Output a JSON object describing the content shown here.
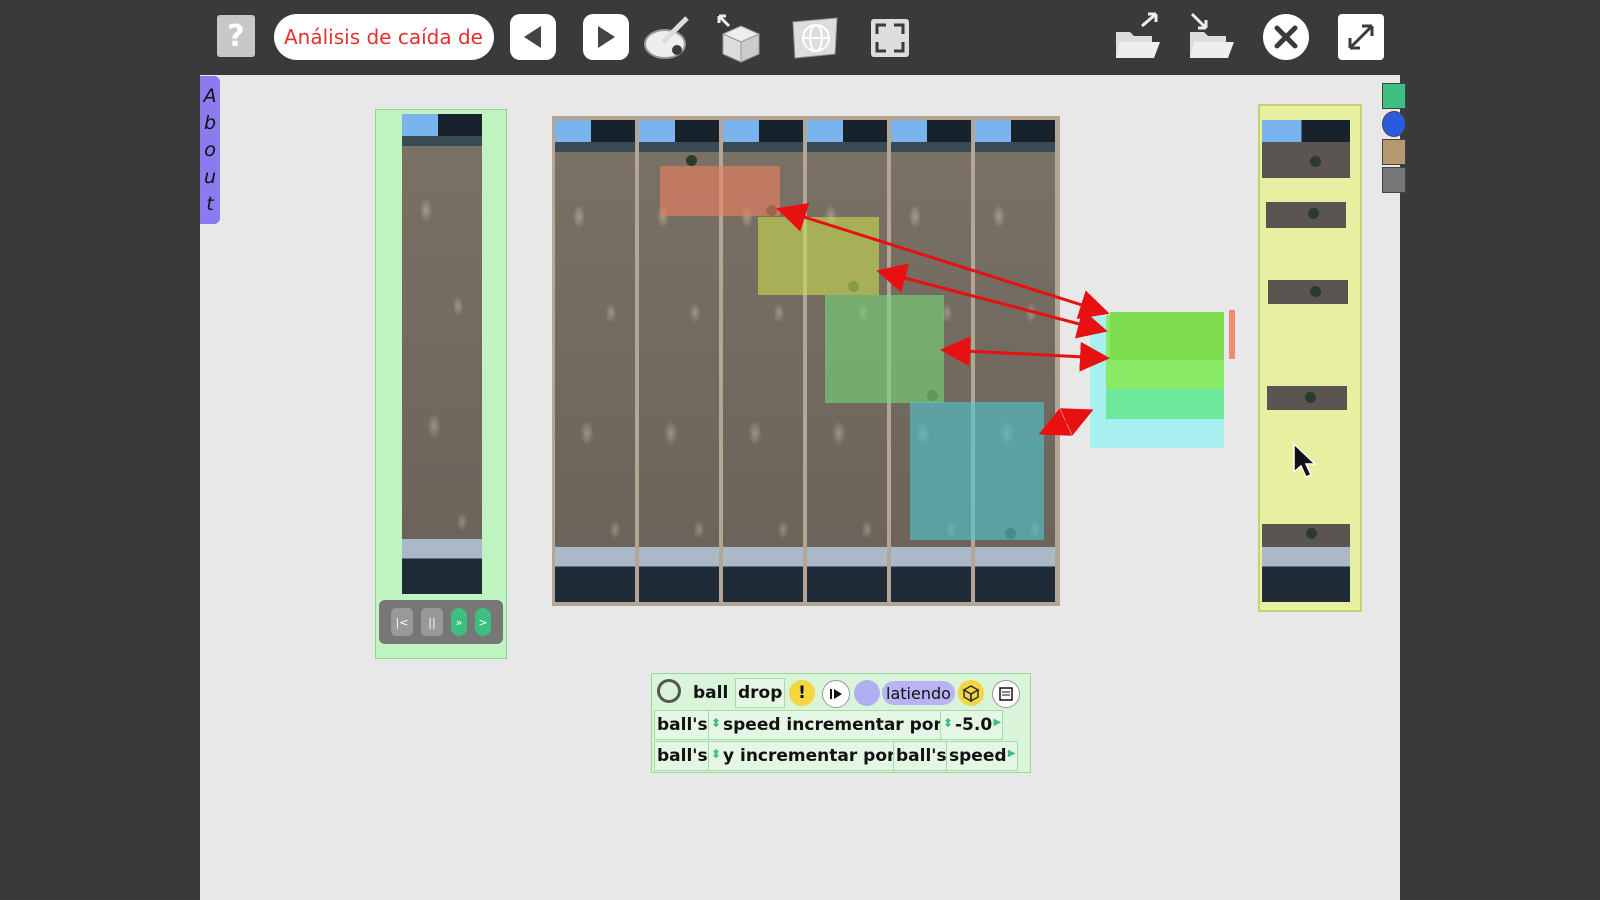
{
  "toolbar": {
    "help_label": "?",
    "project_title": "Análisis de caída de"
  },
  "about_tab": [
    "A",
    "b",
    "o",
    "u",
    "t"
  ],
  "movie_controls": [
    "|<",
    "||",
    "»",
    ">"
  ],
  "script": {
    "object_name": "ball",
    "script_name": "drop",
    "status": "latiendo",
    "row1": {
      "subject": "ball's",
      "property": "speed incrementar por",
      "value": "-5.0"
    },
    "row2": {
      "subject": "ball's",
      "property": "y incrementar por",
      "value_subject": "ball's",
      "value_property": "speed"
    }
  },
  "colors": {
    "track1": "#f08060",
    "track2": "#c8dc50",
    "track3": "#78d878",
    "track4": "#50c8d0",
    "arrow": "#e81010"
  }
}
